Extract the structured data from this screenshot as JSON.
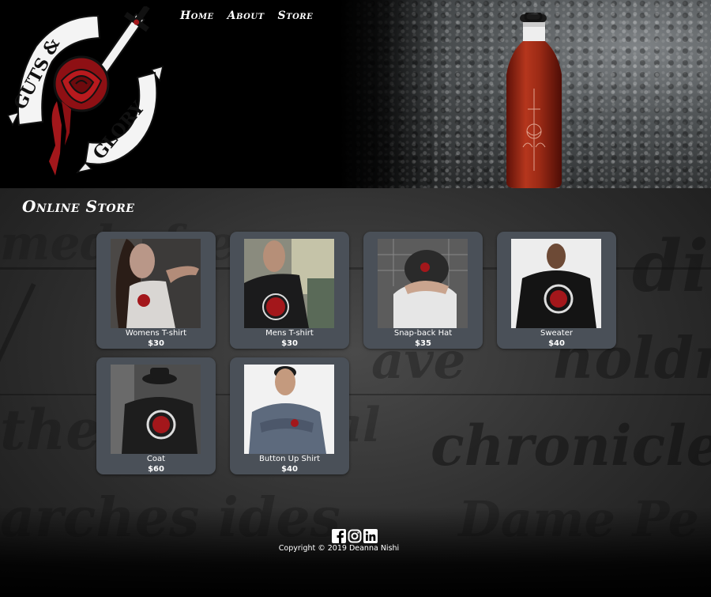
{
  "brand": {
    "logo_text_left": "GUTS &",
    "logo_text_right": "GLORY",
    "accent_red": "#a3171b",
    "card_bg": "#4a5058"
  },
  "nav": {
    "items": [
      "Home",
      "About",
      "Store"
    ]
  },
  "store": {
    "title": "Online Store",
    "products": [
      {
        "name": "Womens T-shirt",
        "price": "$30"
      },
      {
        "name": "Mens T-shirt",
        "price": "$30"
      },
      {
        "name": "Snap-back Hat",
        "price": "$35"
      },
      {
        "name": "Sweater",
        "price": "$40"
      },
      {
        "name": "Coat",
        "price": "$60"
      },
      {
        "name": "Button Up Shirt",
        "price": "$40"
      }
    ]
  },
  "footer": {
    "social_icons": [
      "facebook-icon",
      "instagram-icon",
      "linkedin-icon"
    ],
    "copyright": "Copyright © 2019 Deanna Nishi"
  }
}
